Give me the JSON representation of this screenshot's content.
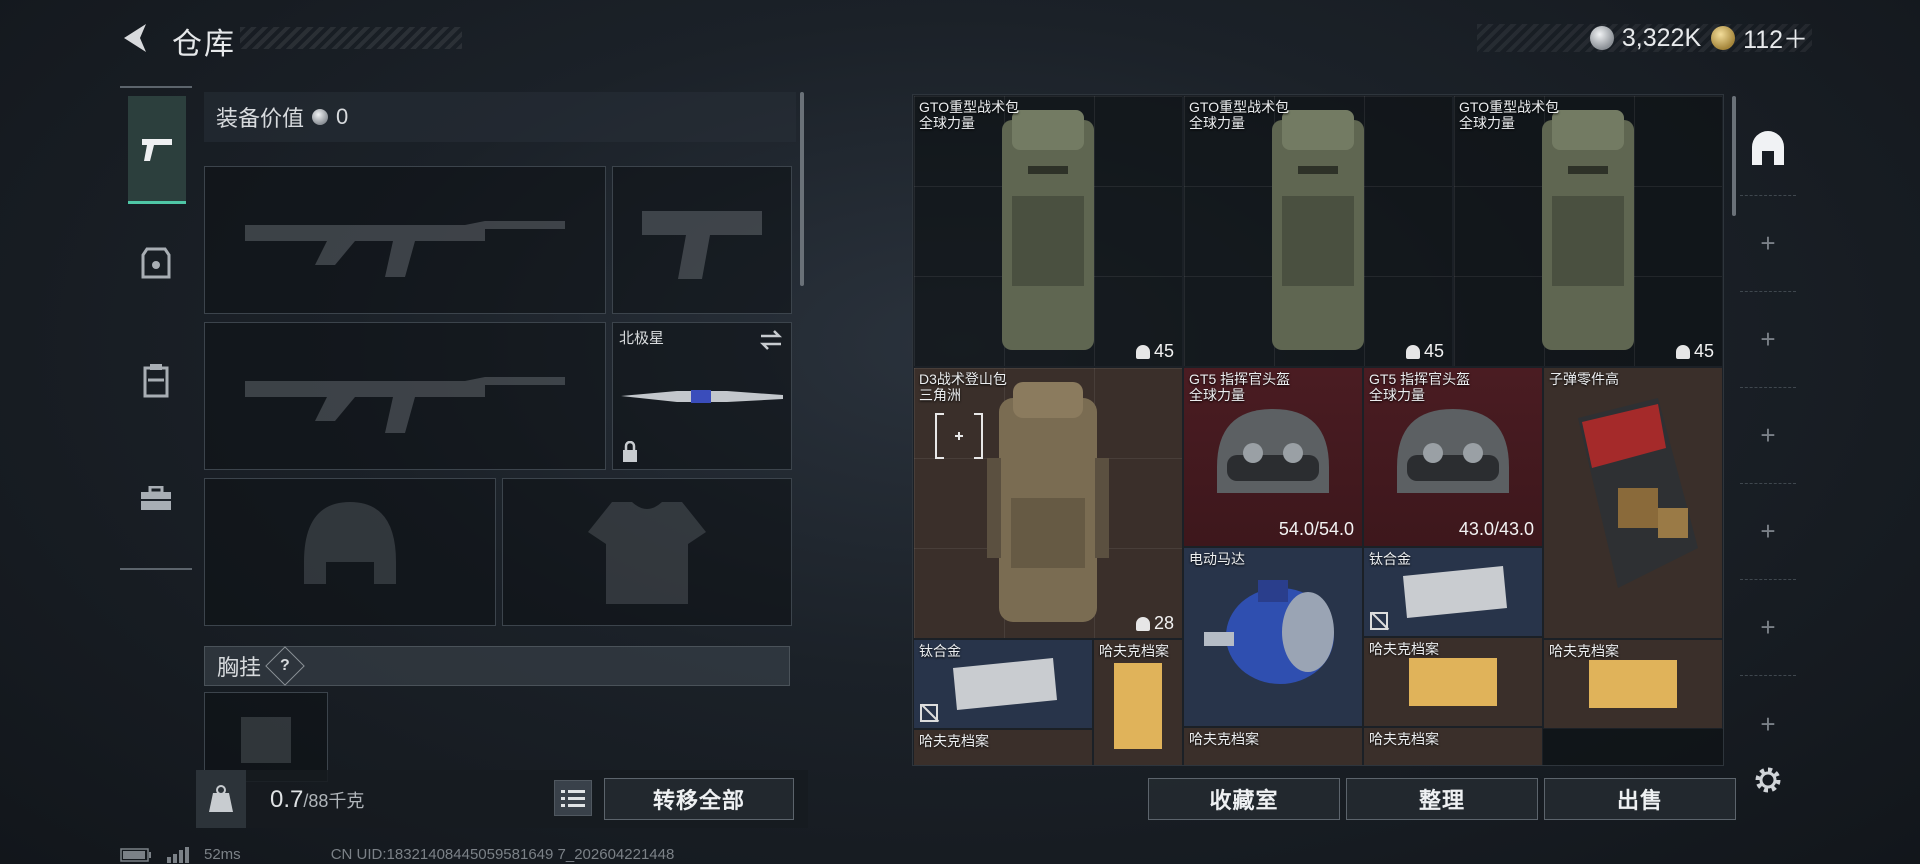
{
  "header": {
    "title": "仓库",
    "currency_silver": "3,322K",
    "currency_gold": "112＋"
  },
  "equipment": {
    "value_label": "装备价值",
    "value": "0",
    "melee_name": "北极星",
    "chest_rig_label": "胸挂",
    "help": "?",
    "weight_value": "0.7",
    "weight_max": "/88千克",
    "transfer_all": "转移全部"
  },
  "stash": {
    "items": [
      {
        "name": "GTO重型战术包",
        "sub": "全球力量",
        "count": "45"
      },
      {
        "name": "GTO重型战术包",
        "sub": "全球力量",
        "count": "45"
      },
      {
        "name": "GTO重型战术包",
        "sub": "全球力量",
        "count": "45"
      },
      {
        "name": "D3战术登山包",
        "sub": "三角洲",
        "count": "28"
      },
      {
        "name": "GT5 指挥官头盔",
        "sub": "全球力量",
        "durability": "54.0/54.0"
      },
      {
        "name": "GT5 指挥官头盔",
        "sub": "全球力量",
        "durability": "43.0/43.0"
      },
      {
        "name": "子弹零件高"
      },
      {
        "name": "电动马达"
      },
      {
        "name": "钛合金"
      },
      {
        "name": "钛合金"
      },
      {
        "name": "哈夫克档案"
      },
      {
        "name": "哈夫克档案"
      },
      {
        "name": "哈夫克档案"
      },
      {
        "name": "哈夫克档案"
      },
      {
        "name": "哈夫克档案"
      },
      {
        "name": "哈夫克档案"
      }
    ],
    "buttons": {
      "collection": "收藏室",
      "organize": "整理",
      "sell": "出售"
    }
  },
  "status": {
    "ping": "52ms",
    "uid": "CN UID:18321408445059581649 7_202604221448"
  },
  "colors": {
    "accent": "#4fc7a6",
    "red_cell": "#4a1c22",
    "brown_cell": "#3a2f2a",
    "blue_cell": "#28344a"
  }
}
